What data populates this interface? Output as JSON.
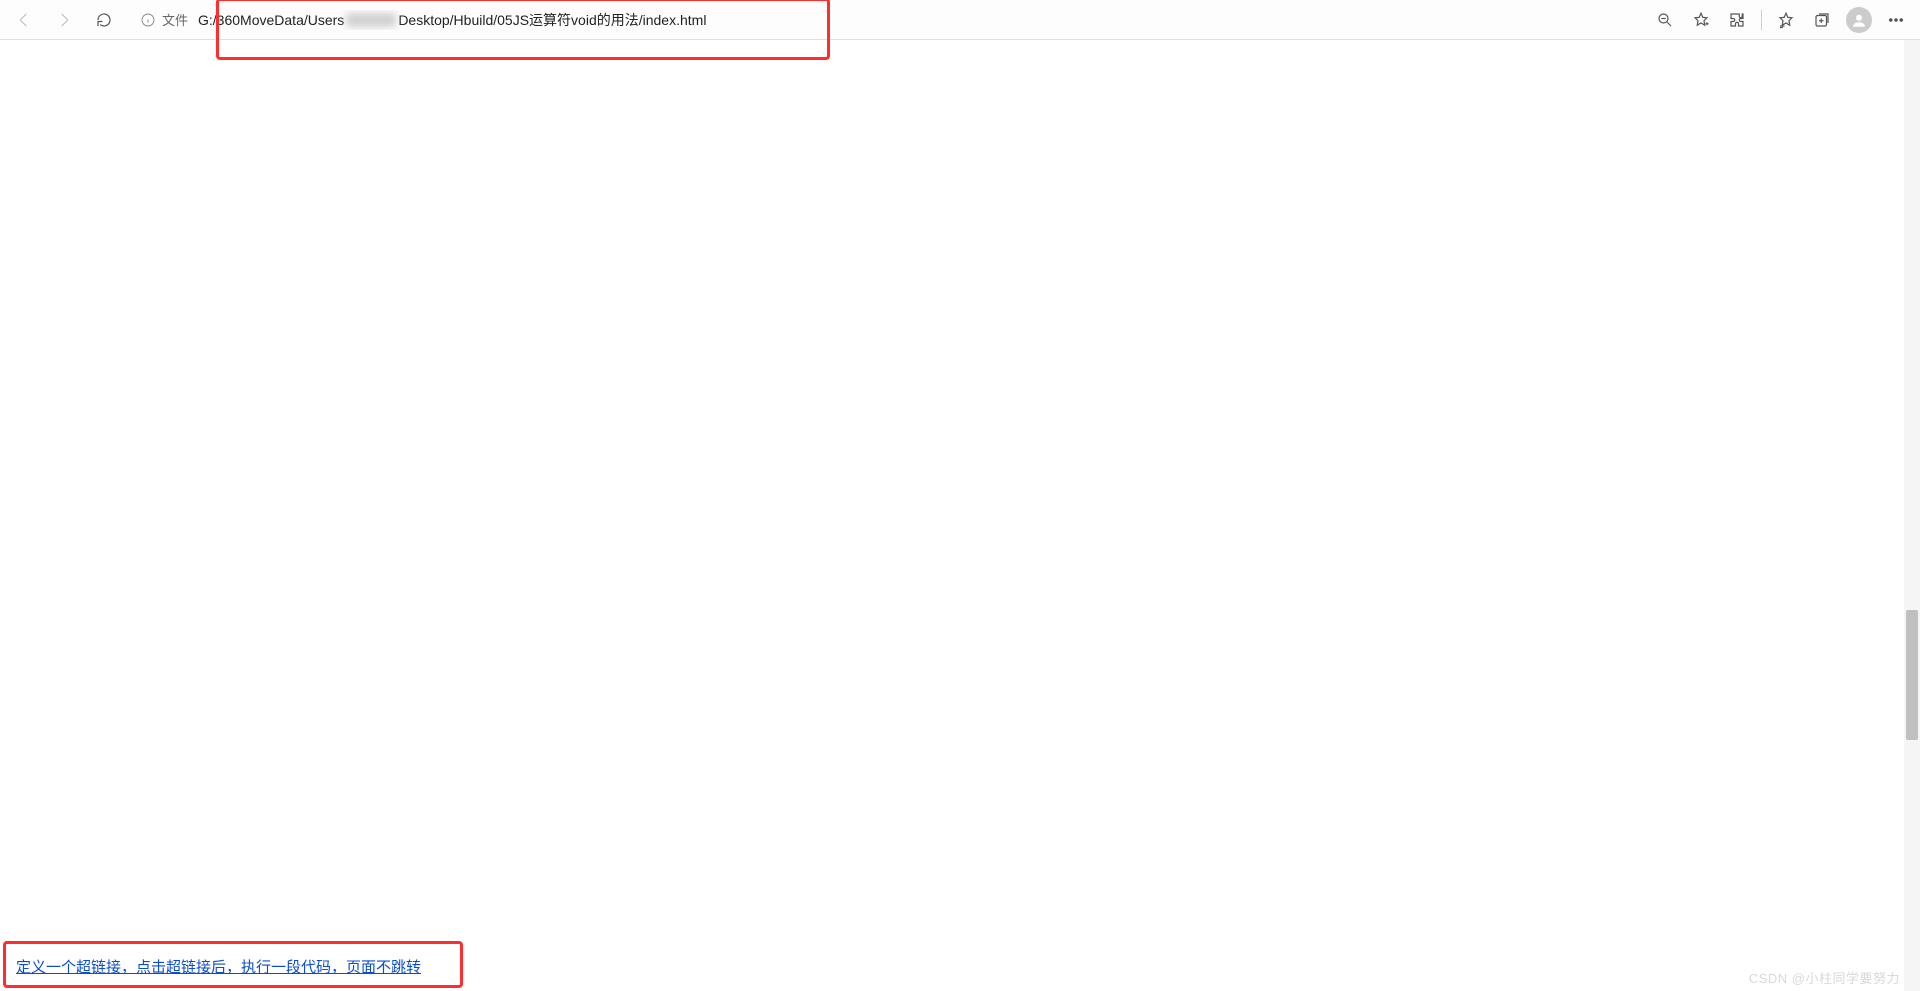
{
  "toolbar": {
    "info_label": "文件",
    "url_prefix": "G:/360MoveData/Users",
    "url_suffix": "Desktop/Hbuild/05JS运算符void的用法/index.html",
    "icons": {
      "back": "back-icon",
      "forward": "forward-icon",
      "refresh": "refresh-icon",
      "info": "info-icon",
      "zoom": "magnify-icon",
      "favorite": "star-icon",
      "extensions": "puzzle-icon",
      "favorites_bar": "favorites-star-icon",
      "collections": "collections-icon",
      "avatar": "avatar-icon",
      "more": "more-icon"
    }
  },
  "page": {
    "link_text": "定义一个超链接，点击超链接后，执行一段代码，页面不跳转"
  },
  "watermark": "CSDN @小柱同学要努力"
}
